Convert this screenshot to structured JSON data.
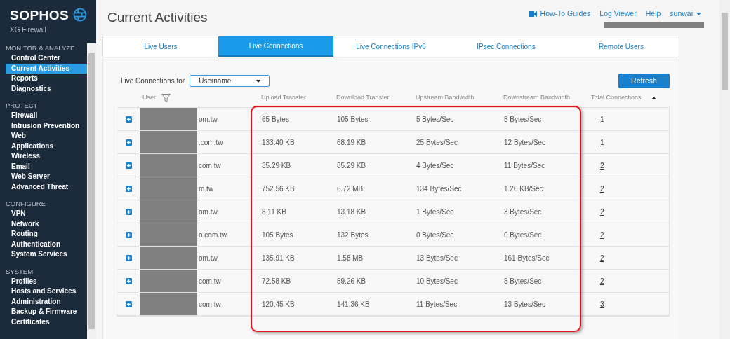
{
  "sidebar": {
    "logo": {
      "brand": "SOPHOS",
      "product": "XG Firewall"
    },
    "sections": [
      {
        "title": "MONITOR & ANALYZE",
        "items": [
          {
            "label": "Control Center",
            "selected": false
          },
          {
            "label": "Current Activities",
            "selected": true
          },
          {
            "label": "Reports",
            "selected": false
          },
          {
            "label": "Diagnostics",
            "selected": false
          }
        ]
      },
      {
        "title": "PROTECT",
        "items": [
          {
            "label": "Firewall",
            "selected": false
          },
          {
            "label": "Intrusion Prevention",
            "selected": false
          },
          {
            "label": "Web",
            "selected": false
          },
          {
            "label": "Applications",
            "selected": false
          },
          {
            "label": "Wireless",
            "selected": false
          },
          {
            "label": "Email",
            "selected": false
          },
          {
            "label": "Web Server",
            "selected": false
          },
          {
            "label": "Advanced Threat",
            "selected": false
          }
        ]
      },
      {
        "title": "CONFIGURE",
        "items": [
          {
            "label": "VPN",
            "selected": false
          },
          {
            "label": "Network",
            "selected": false
          },
          {
            "label": "Routing",
            "selected": false
          },
          {
            "label": "Authentication",
            "selected": false
          },
          {
            "label": "System Services",
            "selected": false
          }
        ]
      },
      {
        "title": "SYSTEM",
        "items": [
          {
            "label": "Profiles",
            "selected": false
          },
          {
            "label": "Hosts and Services",
            "selected": false
          },
          {
            "label": "Administration",
            "selected": false
          },
          {
            "label": "Backup & Firmware",
            "selected": false
          },
          {
            "label": "Certificates",
            "selected": false
          }
        ]
      }
    ]
  },
  "page_title": "Current Activities",
  "top_links": [
    {
      "kind": "video",
      "label": "How-To Guides"
    },
    {
      "kind": "plain",
      "label": "Log Viewer"
    },
    {
      "kind": "plain",
      "label": "Help"
    },
    {
      "kind": "menu",
      "label": "sunwai"
    }
  ],
  "tabs": [
    {
      "label": "Live Users",
      "selected": false
    },
    {
      "label": "Live Connections",
      "selected": true
    },
    {
      "label": "Live Connections IPv6",
      "selected": false
    },
    {
      "label": "IPsec Connections",
      "selected": false
    },
    {
      "label": "Remote Users",
      "selected": false
    }
  ],
  "filter": {
    "label": "Live Connections for",
    "value": "Username"
  },
  "refresh_button": "Refresh",
  "table": {
    "columns": [
      "User",
      "Upload Transfer",
      "Download Transfer",
      "Upstream Bandwidth",
      "Downstream Bandwidth",
      "Total Connections"
    ],
    "rows": [
      {
        "user": "om.tw",
        "upload": "65 Bytes",
        "download": "105 Bytes",
        "upstream": "5 Bytes/Sec",
        "downstream": "8 Bytes/Sec",
        "total": "1"
      },
      {
        "user": ".com.tw",
        "upload": "133.40 KB",
        "download": "68.19 KB",
        "upstream": "25 Bytes/Sec",
        "downstream": "12 Bytes/Sec",
        "total": "1"
      },
      {
        "user": "com.tw",
        "upload": "35.29 KB",
        "download": "85.29 KB",
        "upstream": "4 Bytes/Sec",
        "downstream": "11 Bytes/Sec",
        "total": "2"
      },
      {
        "user": "m.tw",
        "upload": "752.56 KB",
        "download": "6.72 MB",
        "upstream": "134 Bytes/Sec",
        "downstream": "1.20 KB/Sec",
        "total": "2"
      },
      {
        "user": "om.tw",
        "upload": "8.11 KB",
        "download": "13.18 KB",
        "upstream": "1 Bytes/Sec",
        "downstream": "3 Bytes/Sec",
        "total": "2"
      },
      {
        "user": "o.com.tw",
        "upload": "105 Bytes",
        "download": "132 Bytes",
        "upstream": "0 Bytes/Sec",
        "downstream": "0 Bytes/Sec",
        "total": "2"
      },
      {
        "user": "om.tw",
        "upload": "135.91 KB",
        "download": "1.58 MB",
        "upstream": "13 Bytes/Sec",
        "downstream": "161 Bytes/Sec",
        "total": "2"
      },
      {
        "user": "com.tw",
        "upload": "72.58 KB",
        "download": "59.26 KB",
        "upstream": "10 Bytes/Sec",
        "downstream": "8 Bytes/Sec",
        "total": "2"
      },
      {
        "user": "com.tw",
        "upload": "120.45 KB",
        "download": "141.36 KB",
        "upstream": "11 Bytes/Sec",
        "downstream": "13 Bytes/Sec",
        "total": "3"
      }
    ]
  }
}
